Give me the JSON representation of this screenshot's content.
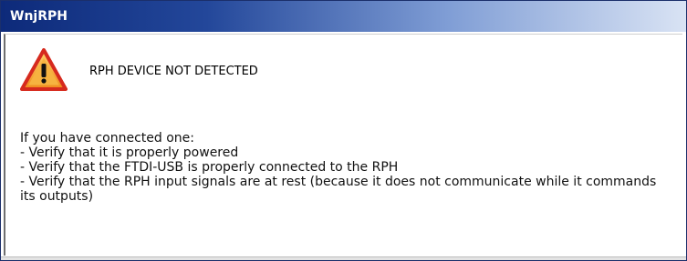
{
  "window": {
    "title": "WnjRPH"
  },
  "alert": {
    "icon": "warning-icon",
    "headline": "RPH DEVICE NOT DETECTED",
    "lines": [
      "If you have connected one:",
      " - Verify that it is properly powered",
      " - Verify that the FTDI-USB is properly connected to the RPH",
      " - Verify that the RPH input signals are at rest (because it does not communicate while it commands its outputs)"
    ]
  },
  "colors": {
    "titlebar_dark": "#0d2a7a",
    "titlebar_light": "#d9e3f4",
    "icon_fill": "#f2a12a",
    "icon_border": "#d62a1e"
  }
}
